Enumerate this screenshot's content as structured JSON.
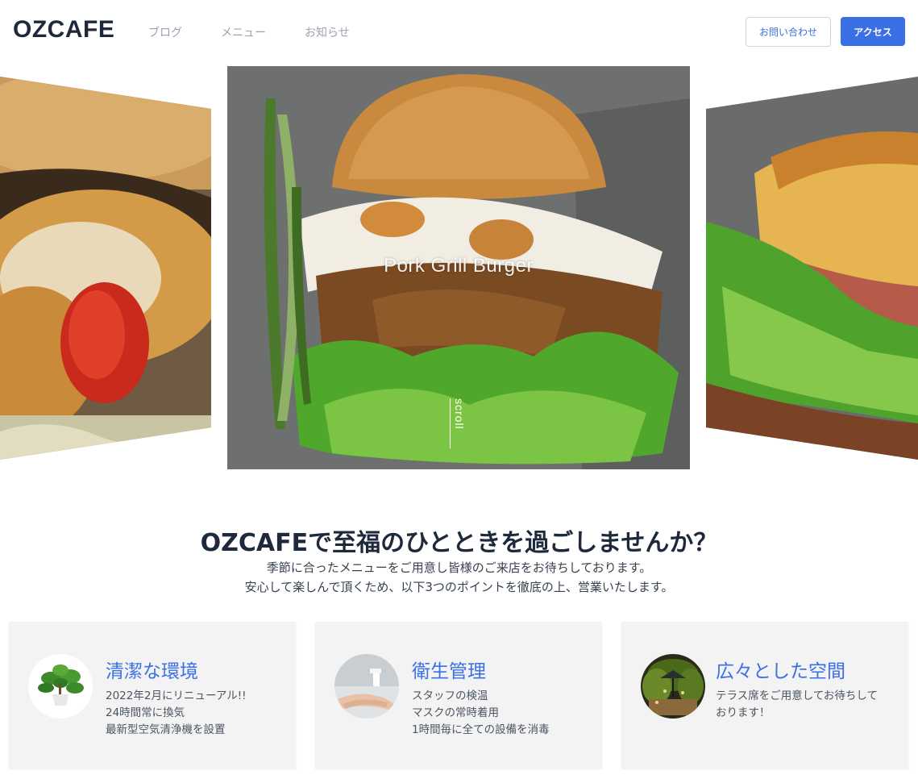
{
  "header": {
    "logo": "OZCAFE",
    "nav": [
      "ブログ",
      "メニュー",
      "お知らせ"
    ],
    "contact_label": "お問い合わせ",
    "access_label": "アクセス",
    "accent_color": "#3b6fe6"
  },
  "hero": {
    "caption": "Pork Grill Burger",
    "scroll_label": "scroll"
  },
  "intro": {
    "title": "OZCAFEで至福のひとときを過ごしませんか？",
    "line1": "季節に合ったメニューをご用意し皆様のご来店をお待ちしております。",
    "line2": "安心して楽しんで頂くため、以下3つのポイントを徹底の上、営業いたします。"
  },
  "cards": [
    {
      "title": "清潔な環境",
      "lines": [
        "2022年2月にリニューアル!!",
        "24時間常に換気",
        "最新型空気清浄機を設置"
      ],
      "icon": "plant-icon"
    },
    {
      "title": "衛生管理",
      "lines": [
        "スタッフの検温",
        "マスクの常時着用",
        "1時間毎に全ての設備を消毒"
      ],
      "icon": "hand-sanitizer-icon"
    },
    {
      "title": "広々とした空間",
      "lines": [
        "テラス席をご用意してお待ちして",
        "おります！"
      ],
      "icon": "terrace-icon"
    }
  ]
}
